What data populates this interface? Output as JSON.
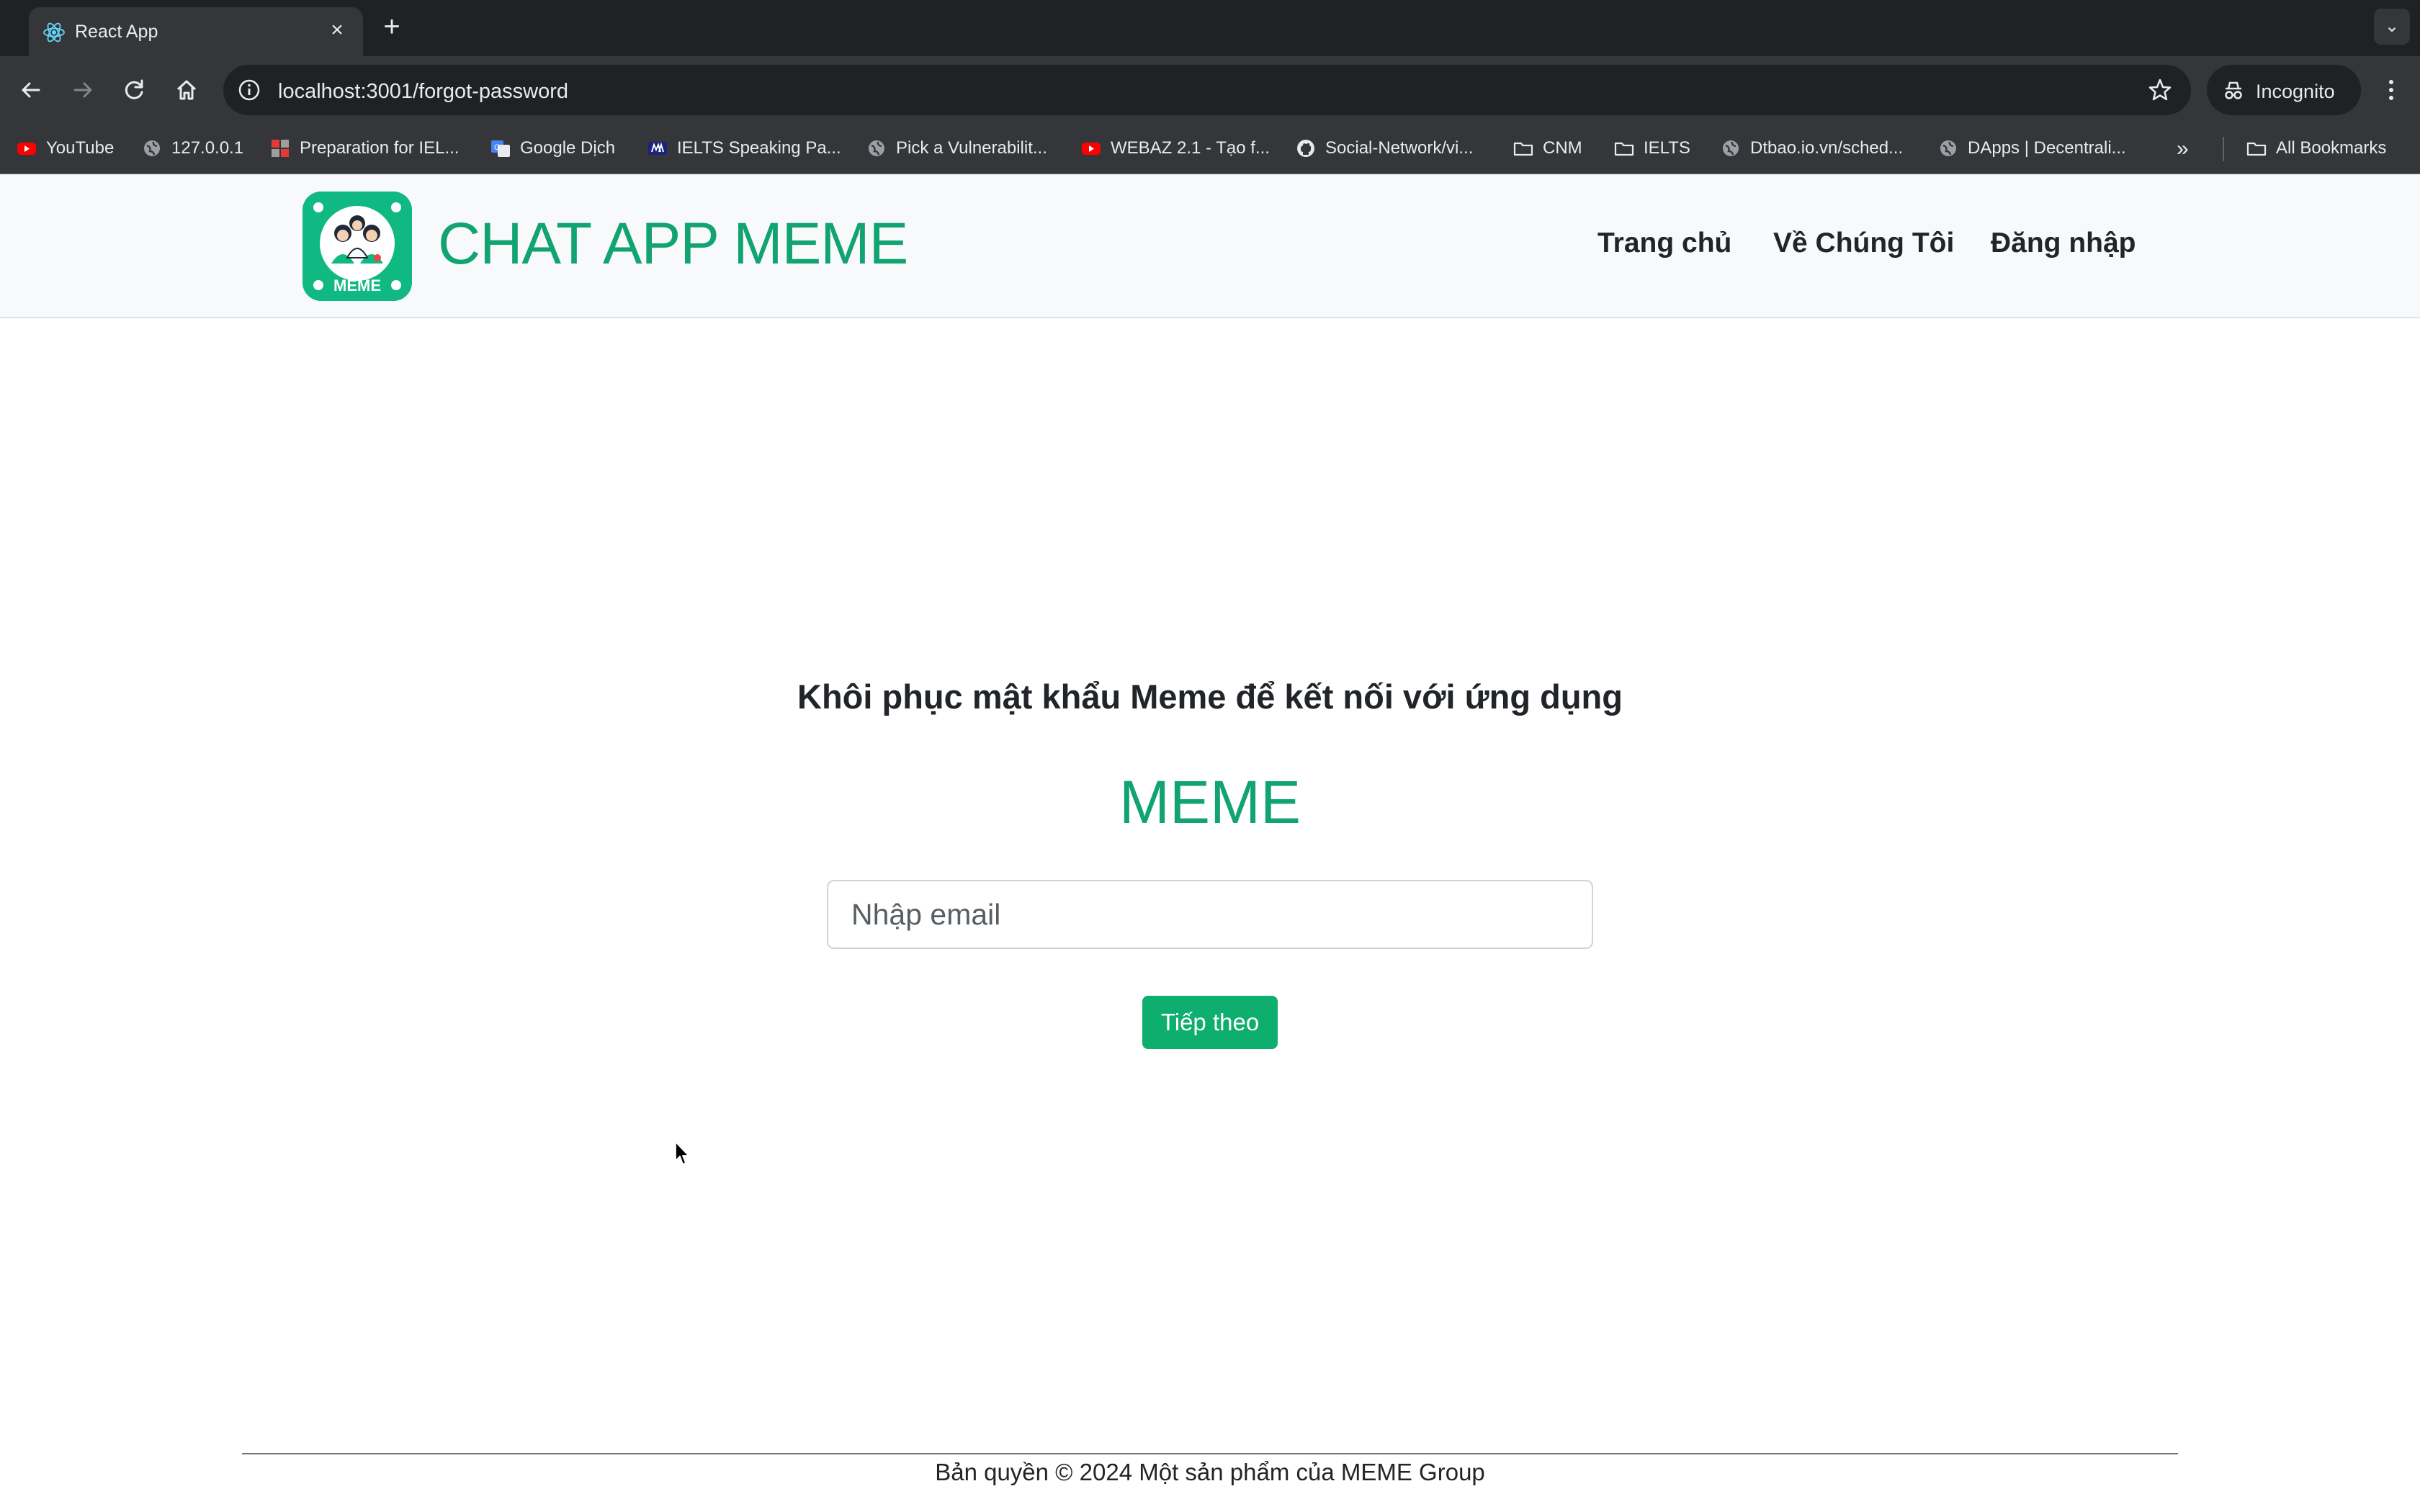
{
  "browser": {
    "tab_title": "React App",
    "url": "localhost:3001/forgot-password",
    "incognito_label": "Incognito",
    "bookmarks": [
      {
        "label": "YouTube",
        "icon": "youtube-icon"
      },
      {
        "label": "127.0.0.1",
        "icon": "globe-icon"
      },
      {
        "label": "Preparation for IEL...",
        "icon": "grid-icon"
      },
      {
        "label": "Google Dịch",
        "icon": "translate-icon"
      },
      {
        "label": "IELTS Speaking Pa...",
        "icon": "m-icon"
      },
      {
        "label": "Pick a Vulnerabilit...",
        "icon": "globe-icon"
      },
      {
        "label": "WEBAZ 2.1 - Tạo f...",
        "icon": "youtube-icon"
      },
      {
        "label": "Social-Network/vi...",
        "icon": "github-icon"
      },
      {
        "label": "CNM",
        "icon": "folder-icon"
      },
      {
        "label": "IELTS",
        "icon": "folder-icon"
      },
      {
        "label": "Dtbao.io.vn/sched...",
        "icon": "globe-icon"
      },
      {
        "label": "DApps | Decentrali...",
        "icon": "globe-icon"
      }
    ],
    "all_bookmarks": "All Bookmarks"
  },
  "navbar": {
    "brand": "CHAT APP MEME",
    "logo_text": "MEME",
    "links": [
      "Trang chủ",
      "Về Chúng Tôi",
      "Đăng nhập"
    ]
  },
  "main": {
    "heading": "Khôi phục mật khẩu Meme để kết nối với ứng dụng",
    "title": "MEME",
    "email_placeholder": "Nhập email",
    "submit_label": "Tiếp theo"
  },
  "footer": {
    "text": "Bản quyền © 2024 Một sản phẩm của MEME Group"
  },
  "colors": {
    "brand_green": "#12a373",
    "button_green": "#0dae6e",
    "chrome_dark": "#202124",
    "chrome_mid": "#35363a"
  }
}
